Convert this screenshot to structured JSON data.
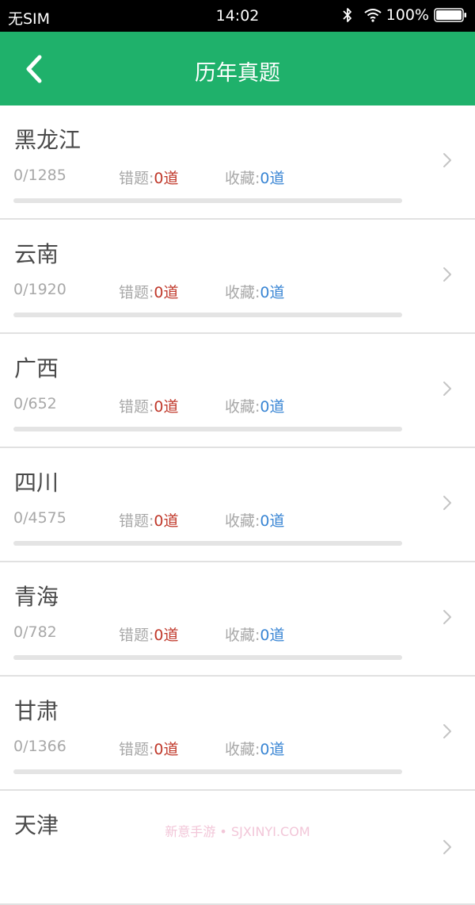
{
  "status_bar": {
    "carrier": "无SIM",
    "time": "14:02",
    "battery_percent": "100%",
    "icons": [
      "bluetooth-icon",
      "wifi-icon",
      "battery-icon"
    ]
  },
  "nav": {
    "title": "历年真题",
    "back_icon": "chevron-left-icon"
  },
  "colors": {
    "accent": "#1fb16b",
    "wrong": "#c0392b",
    "favorite": "#3a86d4"
  },
  "list_labels": {
    "wrong_label": "错题:",
    "fav_label": "收藏:"
  },
  "items": [
    {
      "name": "黑龙江",
      "progress": "0/1285",
      "wrong": "0道",
      "fav": "0道",
      "done_fraction": 0
    },
    {
      "name": "云南",
      "progress": "0/1920",
      "wrong": "0道",
      "fav": "0道",
      "done_fraction": 0
    },
    {
      "name": "广西",
      "progress": "0/652",
      "wrong": "0道",
      "fav": "0道",
      "done_fraction": 0
    },
    {
      "name": "四川",
      "progress": "0/4575",
      "wrong": "0道",
      "fav": "0道",
      "done_fraction": 0
    },
    {
      "name": "青海",
      "progress": "0/782",
      "wrong": "0道",
      "fav": "0道",
      "done_fraction": 0
    },
    {
      "name": "甘肃",
      "progress": "0/1366",
      "wrong": "0道",
      "fav": "0道",
      "done_fraction": 0
    },
    {
      "name": "天津"
    }
  ],
  "watermark": "新意手游 • SJXINYI.COM"
}
